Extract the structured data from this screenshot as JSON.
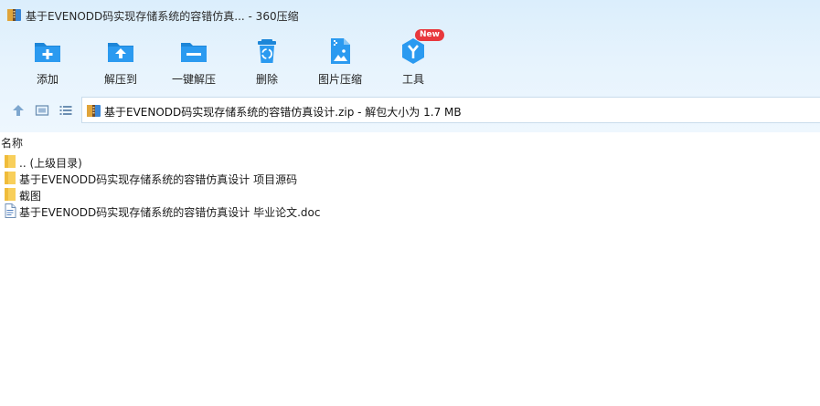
{
  "window": {
    "title": "基于EVENODD码实现存储系统的容错仿真... - 360压缩"
  },
  "toolbar": {
    "items": [
      {
        "label": "添加",
        "icon": "add-icon"
      },
      {
        "label": "解压到",
        "icon": "extract-to-icon"
      },
      {
        "label": "一键解压",
        "icon": "one-click-extract-icon"
      },
      {
        "label": "删除",
        "icon": "delete-icon"
      },
      {
        "label": "图片压缩",
        "icon": "image-compress-icon"
      },
      {
        "label": "工具",
        "icon": "tools-icon",
        "badge": "New"
      }
    ]
  },
  "address": {
    "path": "基于EVENODD码实现存储系统的容错仿真设计.zip - 解包大小为 1.7 MB"
  },
  "list": {
    "column_name": "名称",
    "rows": [
      {
        "name": ".. (上级目录)",
        "type": "folder"
      },
      {
        "name": "基于EVENODD码实现存储系统的容错仿真设计 项目源码",
        "type": "folder"
      },
      {
        "name": "截图",
        "type": "folder"
      },
      {
        "name": "基于EVENODD码实现存储系统的容错仿真设计 毕业论文.doc",
        "type": "doc"
      }
    ]
  },
  "colors": {
    "accent": "#2a8de0",
    "chrome_top": "#dbeefc",
    "folder": "#f8cf5b",
    "badge": "#e8383d"
  }
}
